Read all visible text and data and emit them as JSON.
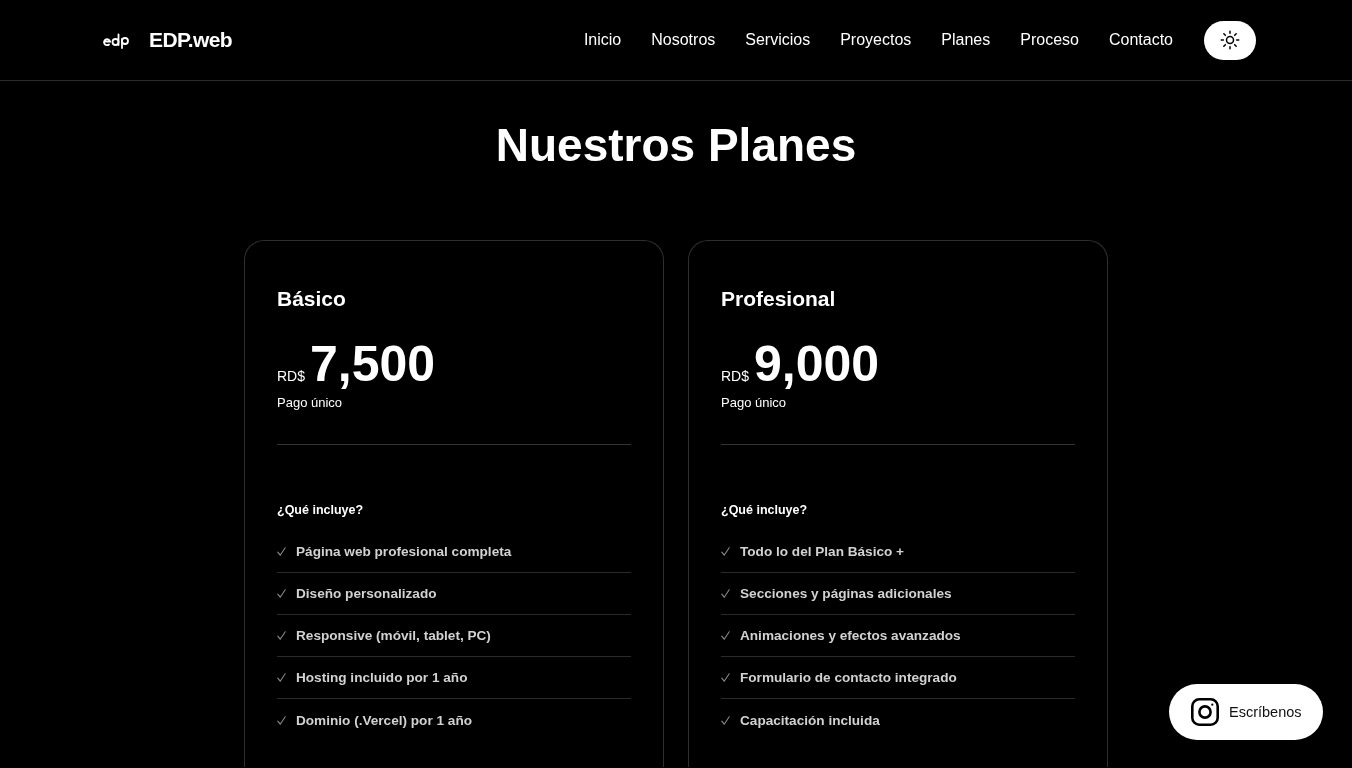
{
  "header": {
    "brand": "EDP.web",
    "nav": [
      {
        "label": "Inicio"
      },
      {
        "label": "Nosotros"
      },
      {
        "label": "Servicios"
      },
      {
        "label": "Proyectos"
      },
      {
        "label": "Planes"
      },
      {
        "label": "Proceso"
      },
      {
        "label": "Contacto"
      }
    ]
  },
  "title": "Nuestros Planes",
  "plans": [
    {
      "name": "Básico",
      "currency": "RD$",
      "price": "7,500",
      "note": "Pago único",
      "features_title": "¿Qué incluye?",
      "features": [
        "Página web profesional completa",
        "Diseño personalizado",
        "Responsive (móvil, tablet, PC)",
        "Hosting incluido por 1 año",
        "Dominio (.Vercel) por 1 año"
      ]
    },
    {
      "name": "Profesional",
      "currency": "RD$",
      "price": "9,000",
      "note": "Pago único",
      "features_title": "¿Qué incluye?",
      "features": [
        "Todo lo del Plan Básico +",
        "Secciones y páginas adicionales",
        "Animaciones y efectos avanzados",
        "Formulario de contacto integrado",
        "Capacitación incluida"
      ]
    }
  ],
  "contact_button": {
    "label": "Escríbenos"
  }
}
